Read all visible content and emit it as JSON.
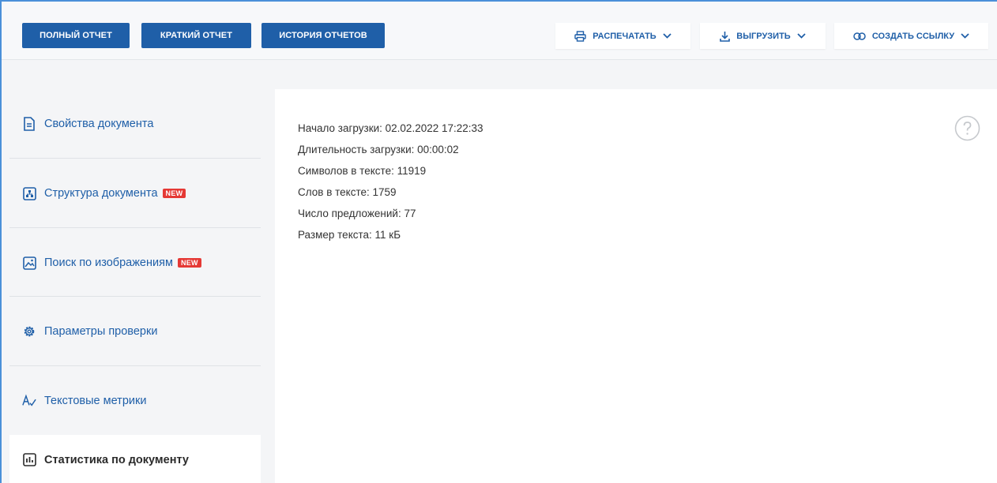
{
  "tabs": [
    {
      "label": "ПОЛНЫЙ ОТЧЕТ"
    },
    {
      "label": "КРАТКИЙ ОТЧЕТ"
    },
    {
      "label": "ИСТОРИЯ ОТЧЕТОВ"
    }
  ],
  "actions": {
    "print": {
      "label": "РАСПЕЧАТАТЬ",
      "icon": "printer-icon"
    },
    "export": {
      "label": "ВЫГРУЗИТЬ",
      "icon": "download-icon"
    },
    "link": {
      "label": "СОЗДАТЬ ССЫЛКУ",
      "icon": "link-icon"
    }
  },
  "sidebar": {
    "items": [
      {
        "label": "Свойства документа",
        "icon": "document-icon"
      },
      {
        "label": "Структура документа",
        "icon": "structure-icon",
        "badge": "NEW"
      },
      {
        "label": "Поиск по изображениям",
        "icon": "image-icon",
        "badge": "NEW"
      },
      {
        "label": "Параметры проверки",
        "icon": "gear-icon"
      },
      {
        "label": "Текстовые метрики",
        "icon": "text-metrics-icon"
      },
      {
        "label": "Статистика по документу",
        "icon": "bar-chart-icon",
        "active": true
      }
    ]
  },
  "stats": {
    "lines": [
      "Начало загрузки: 02.02.2022 17:22:33",
      "Длительность загрузки: 00:00:02",
      "Символов в тексте: 11919",
      "Слов в тексте: 1759",
      "Число предложений: 77",
      "Размер текста: 11 кБ"
    ]
  },
  "colors": {
    "primary": "#1f5fa8",
    "badge": "#e53935",
    "background": "#f4f5f7"
  }
}
